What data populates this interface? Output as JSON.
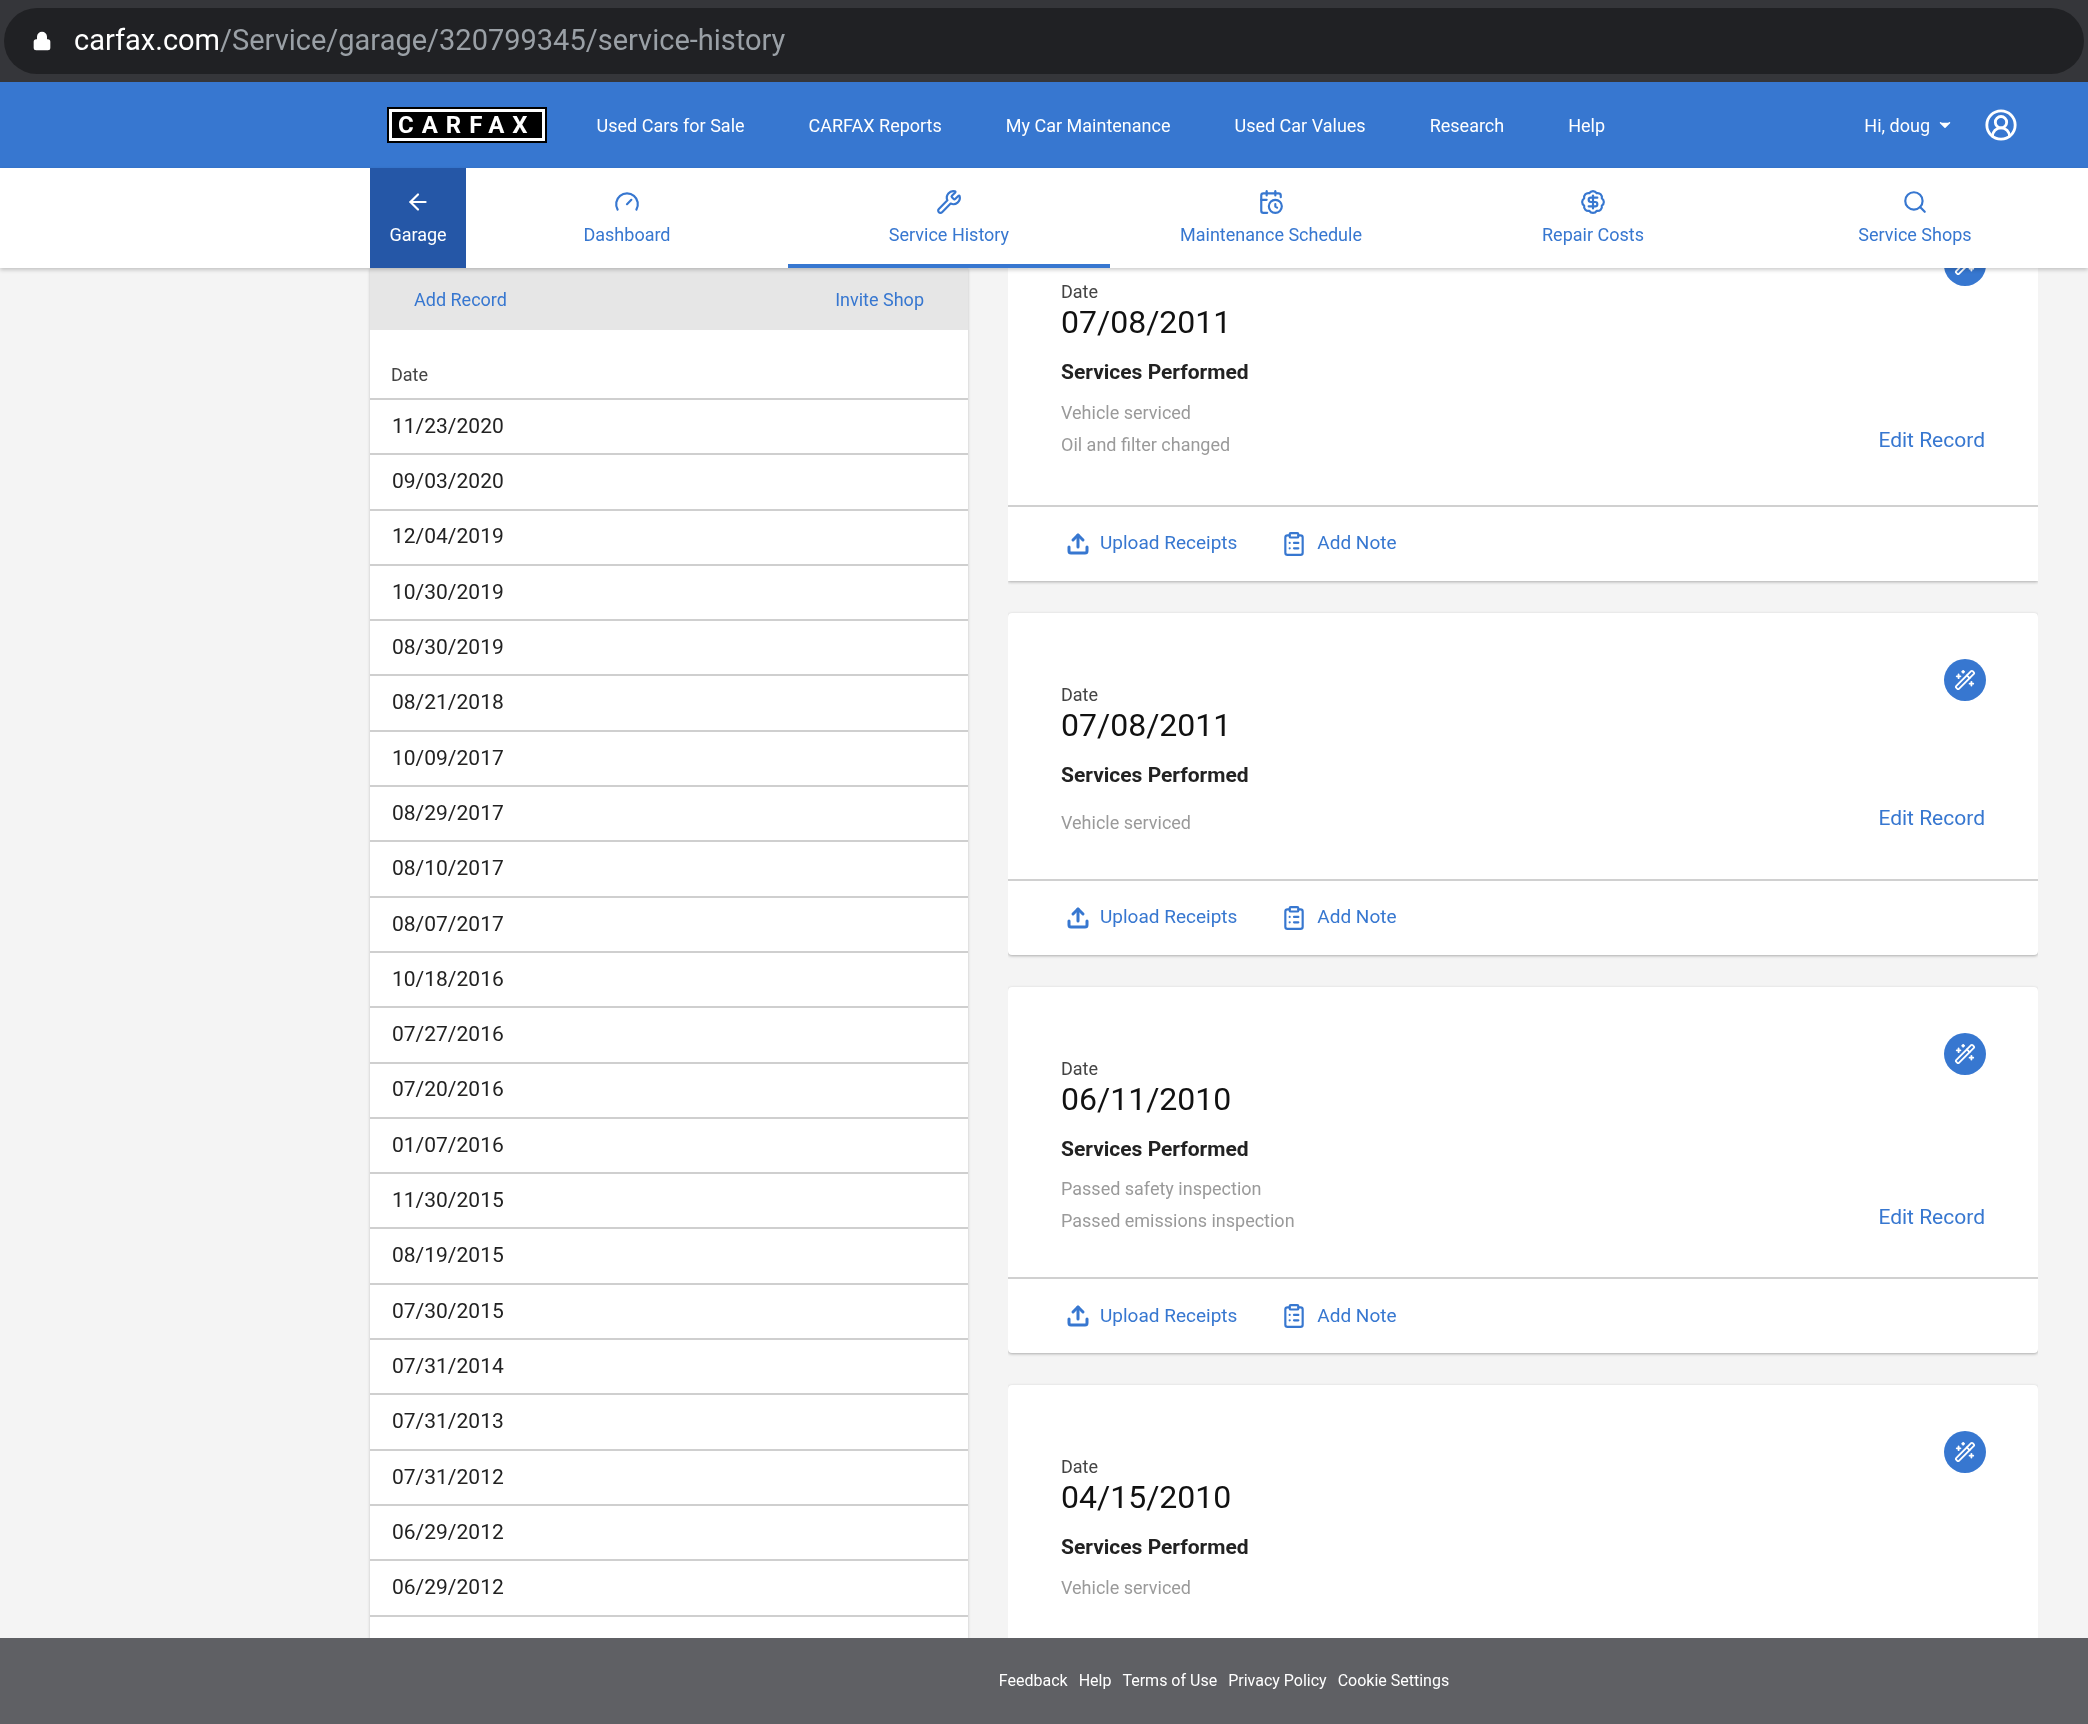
{
  "browser": {
    "url_host": "carfax.com",
    "url_path": "/Service/garage/320799345/service-history"
  },
  "header": {
    "logo": "CARFAX",
    "nav": [
      "Used Cars for Sale",
      "CARFAX Reports",
      "My Car Maintenance",
      "Used Car Values",
      "Research",
      "Help"
    ],
    "user": "Hi, doug"
  },
  "tabs": [
    {
      "label": "Garage",
      "kind": "back",
      "selected": false
    },
    {
      "label": "Dashboard",
      "kind": "gauge",
      "selected": false
    },
    {
      "label": "Service History",
      "kind": "tools",
      "selected": true
    },
    {
      "label": "Maintenance Schedule",
      "kind": "schedule",
      "selected": false
    },
    {
      "label": "Repair Costs",
      "kind": "dollar",
      "selected": false
    },
    {
      "label": "Service Shops",
      "kind": "search",
      "selected": false
    }
  ],
  "sidebar": {
    "actions": [
      "Add Record",
      "Invite Shop"
    ],
    "column": "Date",
    "dates": [
      "11/23/2020",
      "09/03/2020",
      "12/04/2019",
      "10/30/2019",
      "08/30/2019",
      "08/21/2018",
      "10/09/2017",
      "08/29/2017",
      "08/10/2017",
      "08/07/2017",
      "10/18/2016",
      "07/27/2016",
      "07/20/2016",
      "01/07/2016",
      "11/30/2015",
      "08/19/2015",
      "07/30/2015",
      "07/31/2014",
      "07/31/2013",
      "07/31/2012",
      "06/29/2012",
      "06/29/2012"
    ]
  },
  "records": [
    {
      "date_label": "Date",
      "date": "07/08/2011",
      "heading": "Services Performed",
      "services": [
        "Vehicle serviced",
        "Oil and filter changed"
      ],
      "edit": "Edit Record",
      "upload": "Upload Receipts",
      "note": "Add Note"
    },
    {
      "date_label": "Date",
      "date": "07/08/2011",
      "heading": "Services Performed",
      "services": [
        "Vehicle serviced"
      ],
      "edit": "Edit Record",
      "upload": "Upload Receipts",
      "note": "Add Note"
    },
    {
      "date_label": "Date",
      "date": "06/11/2010",
      "heading": "Services Performed",
      "services": [
        "Passed safety inspection",
        "Passed emissions inspection"
      ],
      "edit": "Edit Record",
      "upload": "Upload Receipts",
      "note": "Add Note"
    },
    {
      "date_label": "Date",
      "date": "04/15/2010",
      "heading": "Services Performed",
      "services": [
        "Vehicle serviced"
      ]
    }
  ],
  "footer": [
    "Feedback",
    "Help",
    "Terms of Use",
    "Privacy Policy",
    "Cookie Settings"
  ]
}
